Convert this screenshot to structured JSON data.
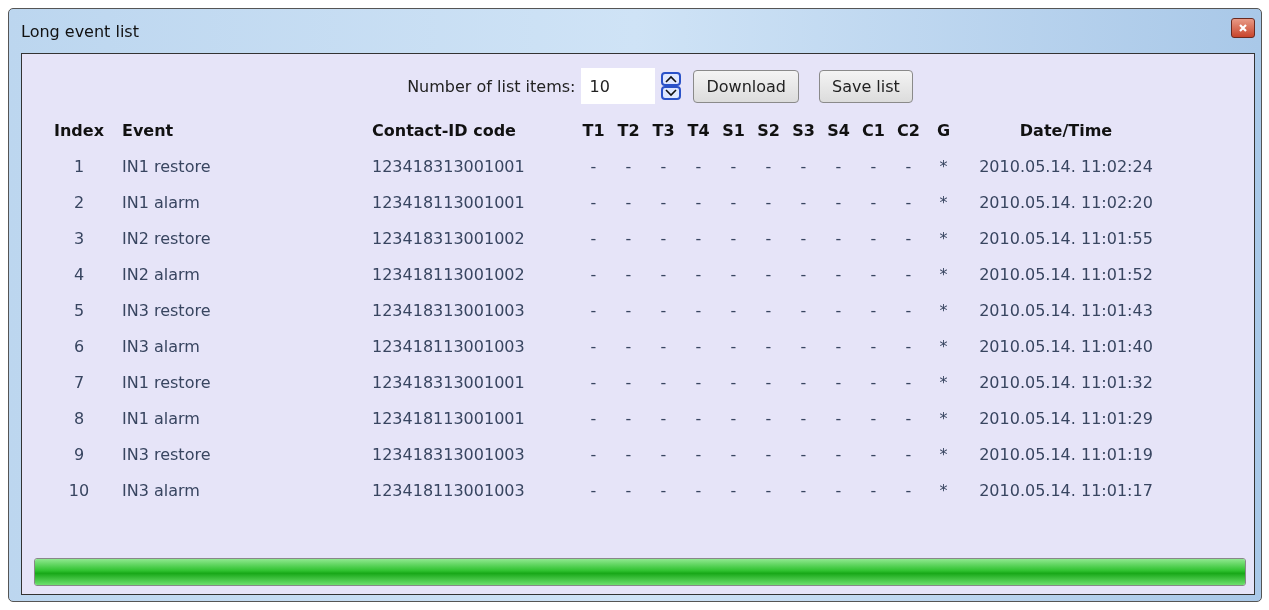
{
  "window": {
    "title": "Long event list"
  },
  "toolbar": {
    "count_label": "Number of list items:",
    "count_value": "10",
    "buttons": [
      "Download",
      "Save list"
    ]
  },
  "table": {
    "columns": [
      "Index",
      "Event",
      "Contact-ID code",
      "T1",
      "T2",
      "T3",
      "T4",
      "S1",
      "S2",
      "S3",
      "S4",
      "C1",
      "C2",
      "G",
      "Date/Time"
    ],
    "rows": [
      {
        "cells": [
          "1",
          "IN1 restore",
          "123418313001001",
          "-",
          "-",
          "-",
          "-",
          "-",
          "-",
          "-",
          "-",
          "-",
          "-",
          "*",
          "2010.05.14. 11:02:24"
        ]
      },
      {
        "cells": [
          "2",
          "IN1 alarm",
          "123418113001001",
          "-",
          "-",
          "-",
          "-",
          "-",
          "-",
          "-",
          "-",
          "-",
          "-",
          "*",
          "2010.05.14. 11:02:20"
        ]
      },
      {
        "cells": [
          "3",
          "IN2 restore",
          "123418313001002",
          "-",
          "-",
          "-",
          "-",
          "-",
          "-",
          "-",
          "-",
          "-",
          "-",
          "*",
          "2010.05.14. 11:01:55"
        ]
      },
      {
        "cells": [
          "4",
          "IN2 alarm",
          "123418113001002",
          "-",
          "-",
          "-",
          "-",
          "-",
          "-",
          "-",
          "-",
          "-",
          "-",
          "*",
          "2010.05.14. 11:01:52"
        ]
      },
      {
        "cells": [
          "5",
          "IN3 restore",
          "123418313001003",
          "-",
          "-",
          "-",
          "-",
          "-",
          "-",
          "-",
          "-",
          "-",
          "-",
          "*",
          "2010.05.14. 11:01:43"
        ]
      },
      {
        "cells": [
          "6",
          "IN3 alarm",
          "123418113001003",
          "-",
          "-",
          "-",
          "-",
          "-",
          "-",
          "-",
          "-",
          "-",
          "-",
          "*",
          "2010.05.14. 11:01:40"
        ]
      },
      {
        "cells": [
          "7",
          "IN1 restore",
          "123418313001001",
          "-",
          "-",
          "-",
          "-",
          "-",
          "-",
          "-",
          "-",
          "-",
          "-",
          "*",
          "2010.05.14. 11:01:32"
        ]
      },
      {
        "cells": [
          "8",
          "IN1 alarm",
          "123418113001001",
          "-",
          "-",
          "-",
          "-",
          "-",
          "-",
          "-",
          "-",
          "-",
          "-",
          "*",
          "2010.05.14. 11:01:29"
        ]
      },
      {
        "cells": [
          "9",
          "IN3 restore",
          "123418313001003",
          "-",
          "-",
          "-",
          "-",
          "-",
          "-",
          "-",
          "-",
          "-",
          "-",
          "*",
          "2010.05.14. 11:01:19"
        ]
      },
      {
        "cells": [
          "10",
          "IN3 alarm",
          "123418113001003",
          "-",
          "-",
          "-",
          "-",
          "-",
          "-",
          "-",
          "-",
          "-",
          "-",
          "*",
          "2010.05.14. 11:01:17"
        ]
      }
    ]
  },
  "progress": {
    "level": 1.0
  }
}
